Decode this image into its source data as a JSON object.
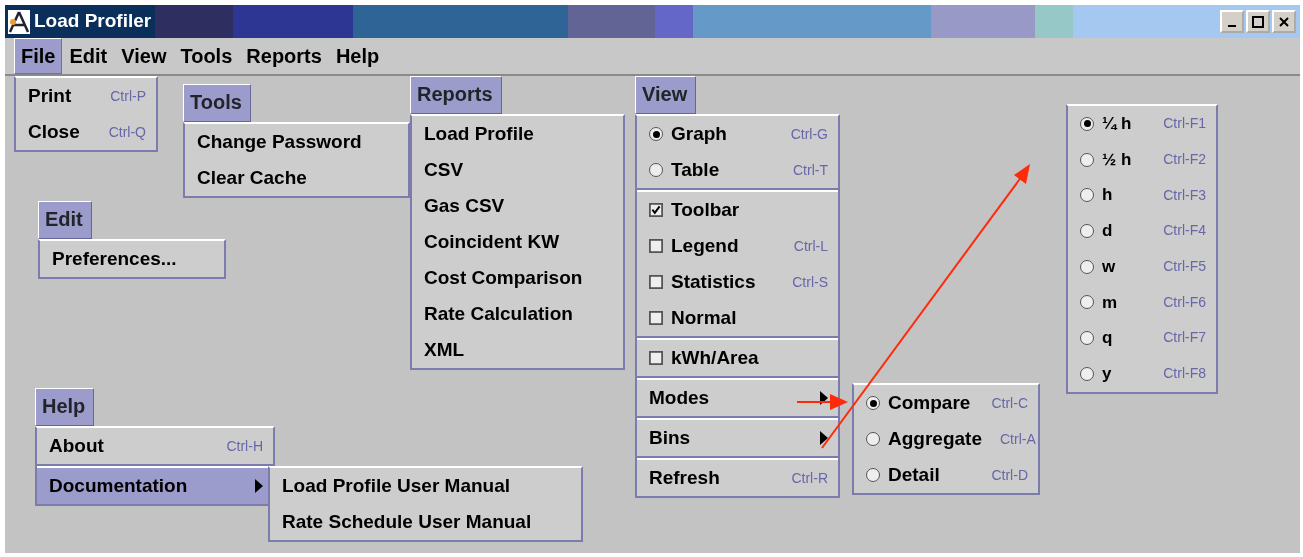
{
  "window": {
    "title": "Load Profiler"
  },
  "menubar": [
    {
      "label": "File",
      "selected": true
    },
    {
      "label": "Edit",
      "selected": false
    },
    {
      "label": "View",
      "selected": false
    },
    {
      "label": "Tools",
      "selected": false
    },
    {
      "label": "Reports",
      "selected": false
    },
    {
      "label": "Help",
      "selected": false
    }
  ],
  "menus": [
    {
      "items": [
        [
          {
            "kind": "plain",
            "label": "Print",
            "shortcut": "Ctrl-P",
            "selected": false
          },
          {
            "kind": "plain",
            "label": "Close",
            "shortcut": "Ctrl-Q",
            "selected": false
          }
        ]
      ]
    },
    {
      "title": "Tools",
      "items": [
        [
          {
            "kind": "plain",
            "label": "Change Password",
            "selected": false
          },
          {
            "kind": "plain",
            "label": "Clear Cache",
            "selected": false
          }
        ]
      ]
    },
    {
      "title": "Edit",
      "items": [
        [
          {
            "kind": "plain",
            "label": "Preferences...",
            "selected": false
          }
        ]
      ]
    },
    {
      "title": "Reports",
      "items": [
        [
          {
            "kind": "plain",
            "label": "Load Profile",
            "selected": false
          },
          {
            "kind": "plain",
            "label": "CSV",
            "selected": false
          },
          {
            "kind": "plain",
            "label": "Gas CSV",
            "selected": false
          },
          {
            "kind": "plain",
            "label": "Coincident KW",
            "selected": false
          },
          {
            "kind": "plain",
            "label": "Cost Comparison",
            "selected": false
          },
          {
            "kind": "plain",
            "label": "Rate Calculation",
            "selected": false
          },
          {
            "kind": "plain",
            "label": "XML",
            "selected": false
          }
        ]
      ]
    },
    {
      "title": "View",
      "items": [
        [
          {
            "kind": "radio",
            "label": "Graph",
            "shortcut": "Ctrl-G",
            "checked": true
          },
          {
            "kind": "radio",
            "label": "Table",
            "shortcut": "Ctrl-T",
            "checked": false
          }
        ],
        [
          {
            "kind": "check",
            "label": "Toolbar",
            "checked": true
          },
          {
            "kind": "check",
            "label": "Legend",
            "shortcut": "Ctrl-L",
            "checked": false
          },
          {
            "kind": "check",
            "label": "Statistics",
            "shortcut": "Ctrl-S",
            "checked": false
          },
          {
            "kind": "check",
            "label": "Normal",
            "checked": false
          }
        ],
        [
          {
            "kind": "check",
            "label": "kWh/Area",
            "checked": false
          }
        ],
        [
          {
            "kind": "submenu",
            "label": "Modes",
            "selected": false
          }
        ],
        [
          {
            "kind": "submenu",
            "label": "Bins",
            "selected": false
          }
        ],
        [
          {
            "kind": "plain",
            "label": "Refresh",
            "shortcut": "Ctrl-R",
            "selected": false
          }
        ]
      ]
    },
    {
      "title": "Help",
      "items": [
        [
          {
            "kind": "plain",
            "label": "About",
            "shortcut": "Ctrl-H",
            "selected": false
          }
        ],
        [
          {
            "kind": "submenu",
            "label": "Documentation",
            "selected": true
          }
        ]
      ]
    },
    {
      "items": [
        [
          {
            "kind": "plain",
            "label": "Load Profile User Manual",
            "selected": false
          },
          {
            "kind": "plain",
            "label": "Rate Schedule User Manual",
            "selected": false
          }
        ]
      ]
    },
    {
      "items": [
        [
          {
            "kind": "radio",
            "label": "Compare",
            "shortcut": "Ctrl-C",
            "checked": true
          },
          {
            "kind": "radio",
            "label": "Aggregate",
            "shortcut": "Ctrl-A",
            "checked": false
          },
          {
            "kind": "radio",
            "label": "Detail",
            "shortcut": "Ctrl-D",
            "checked": false
          }
        ]
      ]
    },
    {
      "items": [
        [
          {
            "kind": "radio",
            "label": "¼ h",
            "shortcut": "Ctrl-F1",
            "checked": true
          },
          {
            "kind": "radio",
            "label": "½ h",
            "shortcut": "Ctrl-F2",
            "checked": false
          },
          {
            "kind": "radio",
            "label": "h",
            "shortcut": "Ctrl-F3",
            "checked": false
          },
          {
            "kind": "radio",
            "label": "d",
            "shortcut": "Ctrl-F4",
            "checked": false
          },
          {
            "kind": "radio",
            "label": "w",
            "shortcut": "Ctrl-F5",
            "checked": false
          },
          {
            "kind": "radio",
            "label": "m",
            "shortcut": "Ctrl-F6",
            "checked": false
          },
          {
            "kind": "radio",
            "label": "q",
            "shortcut": "Ctrl-F7",
            "checked": false
          },
          {
            "kind": "radio",
            "label": "y",
            "shortcut": "Ctrl-F8",
            "checked": false
          }
        ]
      ]
    }
  ]
}
